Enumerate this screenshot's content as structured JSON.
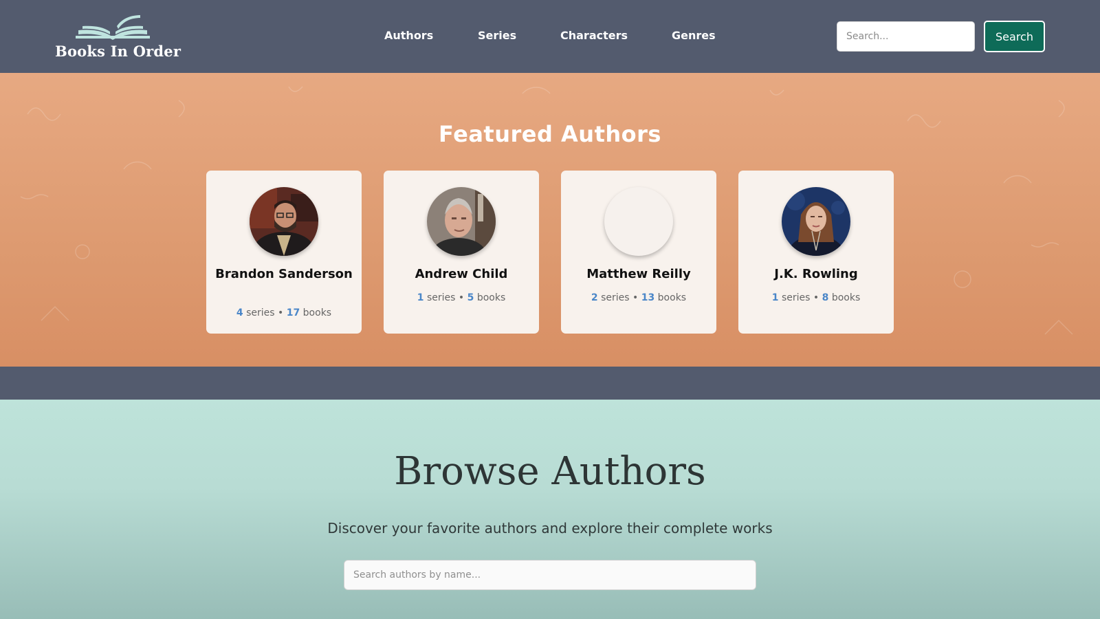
{
  "header": {
    "logo_text": "Books In Order",
    "nav": [
      "Authors",
      "Series",
      "Characters",
      "Genres"
    ],
    "search_placeholder": "Search...",
    "search_button": "Search"
  },
  "featured": {
    "title": "Featured Authors",
    "authors": [
      {
        "name": "Brandon Sanderson",
        "series": "4",
        "books": "17",
        "series_word": "series",
        "books_word": "books",
        "photo": "portrait-bearded-man-glasses"
      },
      {
        "name": "Andrew Child",
        "series": "1",
        "books": "5",
        "series_word": "series",
        "books_word": "books",
        "photo": "portrait-grey-haired-man"
      },
      {
        "name": "Matthew Reilly",
        "series": "2",
        "books": "13",
        "series_word": "series",
        "books_word": "books",
        "photo": "blank"
      },
      {
        "name": "J.K. Rowling",
        "series": "1",
        "books": "8",
        "series_word": "series",
        "books_word": "books",
        "photo": "portrait-woman-dark-background"
      }
    ]
  },
  "browse": {
    "title": "Browse Authors",
    "subtitle": "Discover your favorite authors and explore their complete works",
    "search_placeholder": "Search authors by name..."
  },
  "colors": {
    "nav_bg": "#535b6e",
    "featured_bg": "#e0a078",
    "card_bg": "#f8f2ed",
    "accent_number": "#4a86c8",
    "search_button_bg": "#0e6b58",
    "browse_bg": "#bee3da"
  }
}
